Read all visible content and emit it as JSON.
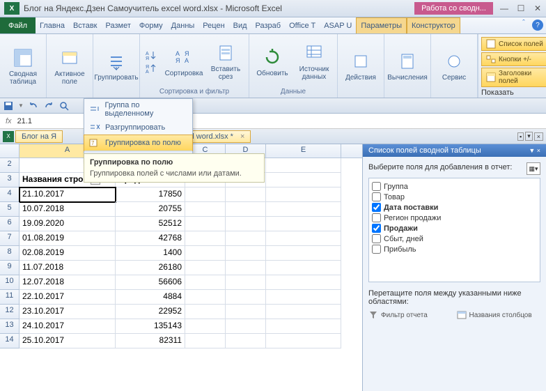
{
  "title": "Блог на Яндекс.Дзен Самоучитель excel word.xlsx  -  Microsoft Excel",
  "context_tab": "Работа со сводн...",
  "menu": {
    "file": "Файл",
    "tabs": [
      "Главна",
      "Вставк",
      "Размет",
      "Форму",
      "Данны",
      "Рецен",
      "Вид",
      "Разраб",
      "Office T",
      "ASAP U"
    ],
    "ctx_tabs": [
      "Параметры",
      "Конструктор"
    ]
  },
  "ribbon": {
    "pivot_table": "Сводная\nтаблица",
    "active_field": "Активное\nполе",
    "group": "Группировать",
    "sort": "Сортировка",
    "slicer": "Вставить\nсрез",
    "refresh": "Обновить",
    "data_source": "Источник\nданных",
    "actions": "Действия",
    "calc": "Вычисления",
    "service": "Сервис",
    "grp_sortfilter": "Сортировка и фильтр",
    "grp_data": "Данные",
    "grp_show": "Показать",
    "field_list": "Список полей",
    "buttons_pm": "Кнопки +/-",
    "field_headers": "Заголовки полей"
  },
  "formula_value": "21.1",
  "doc_tab": "Блог на Я",
  "doc_tab2": "excel word.xlsx *",
  "dropdown": {
    "group_selection": "Группа по выделенному",
    "ungroup": "Разгруппировать",
    "group_field": "Группировка по полю",
    "footer": "Группировать"
  },
  "tooltip": {
    "title": "Группировка по полю",
    "body": "Группировка полей с числами или датами."
  },
  "cols": [
    "A",
    "B",
    "C",
    "D",
    "E"
  ],
  "headers": {
    "rowlabels": "Названия строк",
    "sales": "Продажи."
  },
  "rows": [
    {
      "n": 4,
      "a": "21.10.2017",
      "b": "17850"
    },
    {
      "n": 5,
      "a": "10.07.2018",
      "b": "20755"
    },
    {
      "n": 6,
      "a": "19.09.2020",
      "b": "52512"
    },
    {
      "n": 7,
      "a": "01.08.2019",
      "b": "42768"
    },
    {
      "n": 8,
      "a": "02.08.2019",
      "b": "1400"
    },
    {
      "n": 9,
      "a": "11.07.2018",
      "b": "26180"
    },
    {
      "n": 10,
      "a": "12.07.2018",
      "b": "56606"
    },
    {
      "n": 11,
      "a": "22.10.2017",
      "b": "4884"
    },
    {
      "n": 12,
      "a": "23.10.2017",
      "b": "22952"
    },
    {
      "n": 13,
      "a": "24.10.2017",
      "b": "135143"
    },
    {
      "n": 14,
      "a": "25.10.2017",
      "b": "82311"
    }
  ],
  "fieldpane": {
    "title": "Список полей сводной таблицы",
    "hint": "Выберите поля для добавления в отчет:",
    "fields": [
      {
        "label": "Группа",
        "checked": false,
        "bold": false
      },
      {
        "label": "Товар",
        "checked": false,
        "bold": false
      },
      {
        "label": "Дата поставки",
        "checked": true,
        "bold": true
      },
      {
        "label": "Регион продажи",
        "checked": false,
        "bold": false
      },
      {
        "label": "Продажи",
        "checked": true,
        "bold": true
      },
      {
        "label": "Сбыт, дней",
        "checked": false,
        "bold": false
      },
      {
        "label": "Прибыль",
        "checked": false,
        "bold": false
      }
    ],
    "drag_hint": "Перетащите поля между указанными ниже областями:",
    "report_filter": "Фильтр отчета",
    "col_labels": "Названия столбцов"
  }
}
